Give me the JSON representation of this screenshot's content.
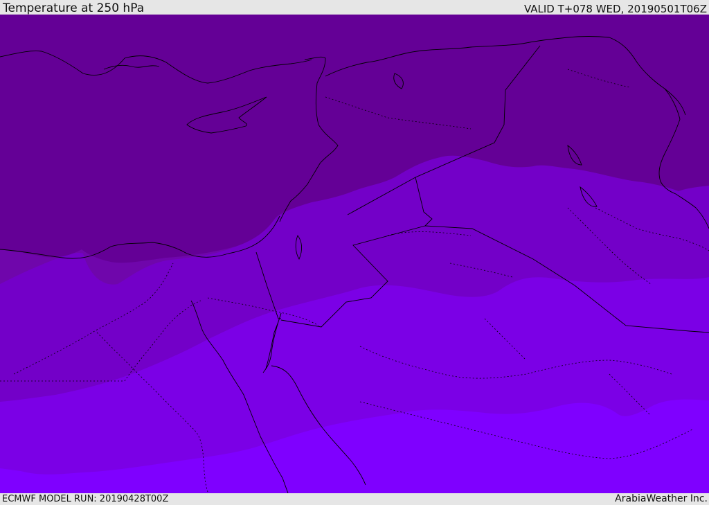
{
  "header": {
    "title": "Temperature at 250 hPa",
    "valid_time": "VALID T+078 WED, 20190501T06Z"
  },
  "footer": {
    "model_run": "ECMWF MODEL RUN: 20190428T00Z",
    "credit": "ArabiaWeather Inc."
  },
  "map": {
    "colors": {
      "band_1": "#640096",
      "band_2": "#6f06ab",
      "band_3": "#7300c8",
      "band_4": "#7b00e6",
      "band_5": "#7f00ff",
      "coastline": "#000000",
      "border": "#1a0030"
    }
  }
}
